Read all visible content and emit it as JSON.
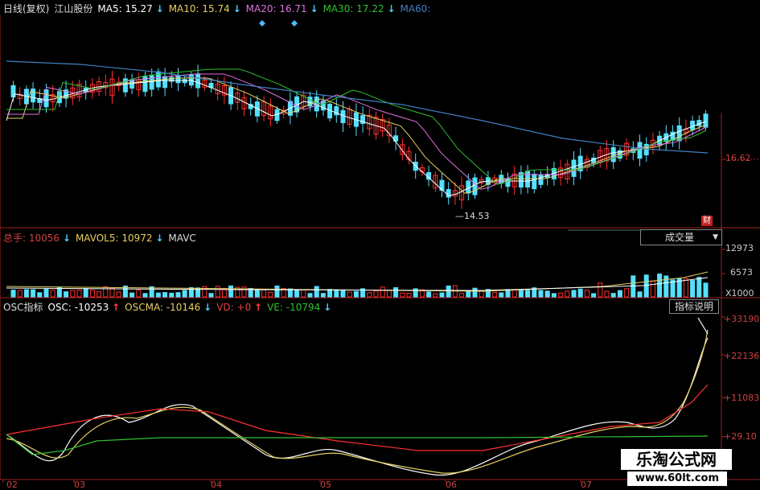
{
  "header": {
    "period": "日线(复权)",
    "stock": "江山股份",
    "ma5": "MA5: 15.27",
    "ma10": "MA10: 15.74",
    "ma20": "MA20: 16.71",
    "ma30": "MA30: 17.22",
    "ma60": "MA60:"
  },
  "price_panel": {
    "right_price": "16.62",
    "low_marker": "14.53",
    "cai_badge": "财"
  },
  "volume_panel": {
    "total": "总手: 10056",
    "mavol5": "MAVOL5: 10972",
    "mavol10": "MAVC",
    "dropdown": "成交量",
    "dropdown_arrow": "▼",
    "axis": [
      "12973",
      "6573",
      "X1000"
    ]
  },
  "osc_panel": {
    "name": "OSC指标",
    "osc": "OSC: -10253",
    "oscma": "OSCMA: -10146",
    "vd": "VD: +0",
    "ve": "VE: -10794",
    "help_button": "指标说明",
    "axis": [
      "+33190",
      "+22136",
      "+11083",
      "+29.10"
    ]
  },
  "x_axis": [
    "02",
    "03",
    "04",
    "05",
    "06",
    "07"
  ],
  "watermark": {
    "title": "乐淘公式网",
    "url": "www.60lt.com"
  },
  "colors": {
    "up": "#ff3030",
    "down": "#55e0ff",
    "ma5": "#ffffff",
    "ma10": "#e8d060",
    "ma20": "#e070e0",
    "ma30": "#30c030",
    "ma60": "#4080c0",
    "axis": "#a02020"
  }
}
